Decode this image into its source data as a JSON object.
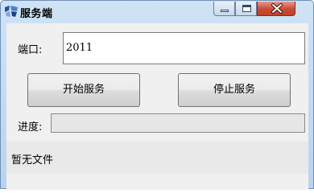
{
  "window": {
    "title": "服务端",
    "controls": {
      "minimize_icon": "minimize-icon",
      "maximize_icon": "maximize-icon",
      "close_icon": "close-icon"
    }
  },
  "form": {
    "port_label": "端口:",
    "port_value": "2011",
    "start_button": "开始服务",
    "stop_button": "停止服务",
    "progress_label": "进度:",
    "progress_value": 0,
    "status_text": "暂无文件"
  },
  "colors": {
    "title_bar": "#b9d3ee",
    "close_button": "#c94a34",
    "client_background": "#f0f0f0"
  }
}
